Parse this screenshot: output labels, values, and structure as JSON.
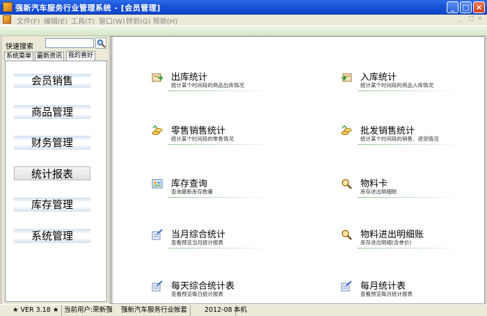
{
  "window": {
    "title": "强新汽车服务行业管理系统 - [会员管理]",
    "controls": [
      "_",
      "□",
      "×"
    ]
  },
  "menu": {
    "items": [
      "文件(F)",
      "编辑(E)",
      "工具(T)",
      "窗口(W)",
      "转到(G)",
      "帮助(H)"
    ],
    "mdi_controls": [
      "_",
      "□",
      "×"
    ]
  },
  "sidebar": {
    "search_label": "快速搜索",
    "search_value": "",
    "tabs": [
      "系统菜单",
      "最新资讯",
      "我的喜好"
    ],
    "active_tab": "我的喜好",
    "nav": [
      "会员销售",
      "商品管理",
      "财务管理",
      "统计报表",
      "库存管理",
      "系统管理"
    ],
    "active_nav": "统计报表"
  },
  "main": {
    "items": [
      {
        "title": "出库统计",
        "desc": "统计某个时间段的商品出库情况",
        "icon": "box-out-icon"
      },
      {
        "title": "入库统计",
        "desc": "统计某个时间段的商品入库情况",
        "icon": "box-in-icon"
      },
      {
        "title": "零售销售统计",
        "desc": "统计某个时间段的零售情况",
        "icon": "coins-icon"
      },
      {
        "title": "批发销售统计",
        "desc": "统计某个时间段的销售、退货情况",
        "icon": "coins-icon"
      },
      {
        "title": "库存查询",
        "desc": "查询最新库存数量",
        "icon": "inventory-icon"
      },
      {
        "title": "物料卡",
        "desc": "库存进出明细账",
        "icon": "magnifier-icon"
      },
      {
        "title": "当月综合统计",
        "desc": "查看预览当月统计报表",
        "icon": "report-pen-icon"
      },
      {
        "title": "物料进出明细账",
        "desc": "库存进出明细(含单价)",
        "icon": "magnifier-icon"
      },
      {
        "title": "每天综合统计表",
        "desc": "查看预览每日统计报表",
        "icon": "report-pen-icon"
      },
      {
        "title": "每月统计表",
        "desc": "查看预览每月统计报表",
        "icon": "report-pen-icon"
      }
    ]
  },
  "status": {
    "version": "★ VER 3.18 ★",
    "user": "当前用户:荣新强",
    "account": "强新汽车服务行业帐套",
    "period": "2012-08",
    "location": "本机"
  },
  "colors": {
    "titlebar": "#1a54d8",
    "toolbar_green": "#d6e6c8",
    "nav_gradient": "#cfe0f0",
    "underline": "#8fc08f"
  }
}
